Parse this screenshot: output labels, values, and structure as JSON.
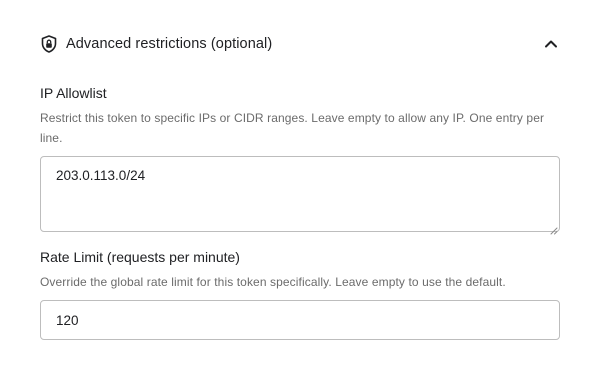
{
  "section": {
    "title": "Advanced restrictions (optional)",
    "icon": "shield-lock-icon",
    "toggle_icon": "chevron-up-icon",
    "expanded": true
  },
  "ip_allowlist": {
    "label": "IP Allowlist",
    "help": "Restrict this token to specific IPs or CIDR ranges. Leave empty to allow any IP. One entry per line.",
    "value": "203.0.113.0/24"
  },
  "rate_limit": {
    "label": "Rate Limit (requests per minute)",
    "help": "Override the global rate limit for this token specifically. Leave empty to use the default.",
    "value": "120"
  },
  "colors": {
    "text": "#202124",
    "muted": "#6b6b6b",
    "border": "#bdbdbd"
  }
}
